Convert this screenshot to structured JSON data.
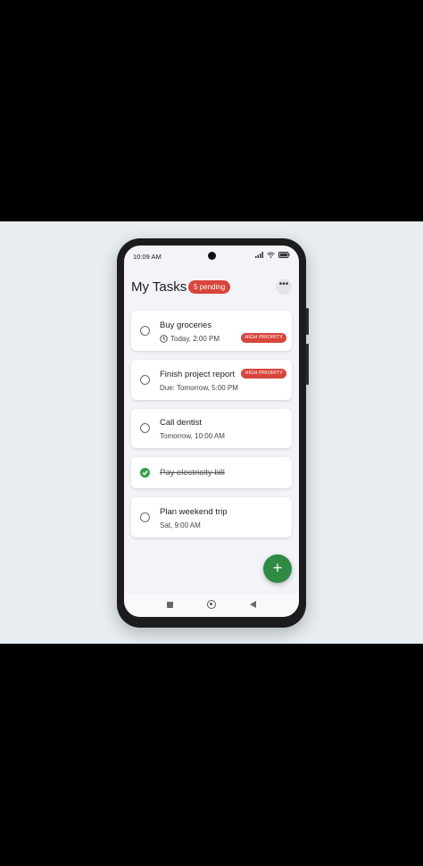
{
  "status_bar": {
    "time": "10:09 AM"
  },
  "header": {
    "title": "My Tasks",
    "pending_badge": "5 pending",
    "more_icon": "more-horizontal-icon"
  },
  "tasks": [
    {
      "title": "Buy groceries",
      "subtitle": "Today, 2:00 PM",
      "has_clock": true,
      "priority": "HIGH PRIORITY",
      "completed": false
    },
    {
      "title": "Finish project report",
      "subtitle": "Due: Tomorrow, 5:00 PM",
      "has_clock": false,
      "priority": "HIGH PRIORITY",
      "completed": false
    },
    {
      "title": "Call dentist",
      "subtitle": "Tomorrow, 10:00 AM",
      "has_clock": false,
      "priority": "",
      "completed": false
    },
    {
      "title": "Pay electricity bill",
      "subtitle": "",
      "has_clock": false,
      "priority": "",
      "completed": true
    },
    {
      "title": "Plan weekend trip",
      "subtitle": "Sat, 9:00 AM",
      "has_clock": false,
      "priority": "",
      "completed": false
    }
  ],
  "fab": {
    "icon": "+"
  },
  "colors": {
    "accent_red": "#d9453c",
    "accent_green": "#34a04e",
    "fab_green": "#2f8a44"
  }
}
